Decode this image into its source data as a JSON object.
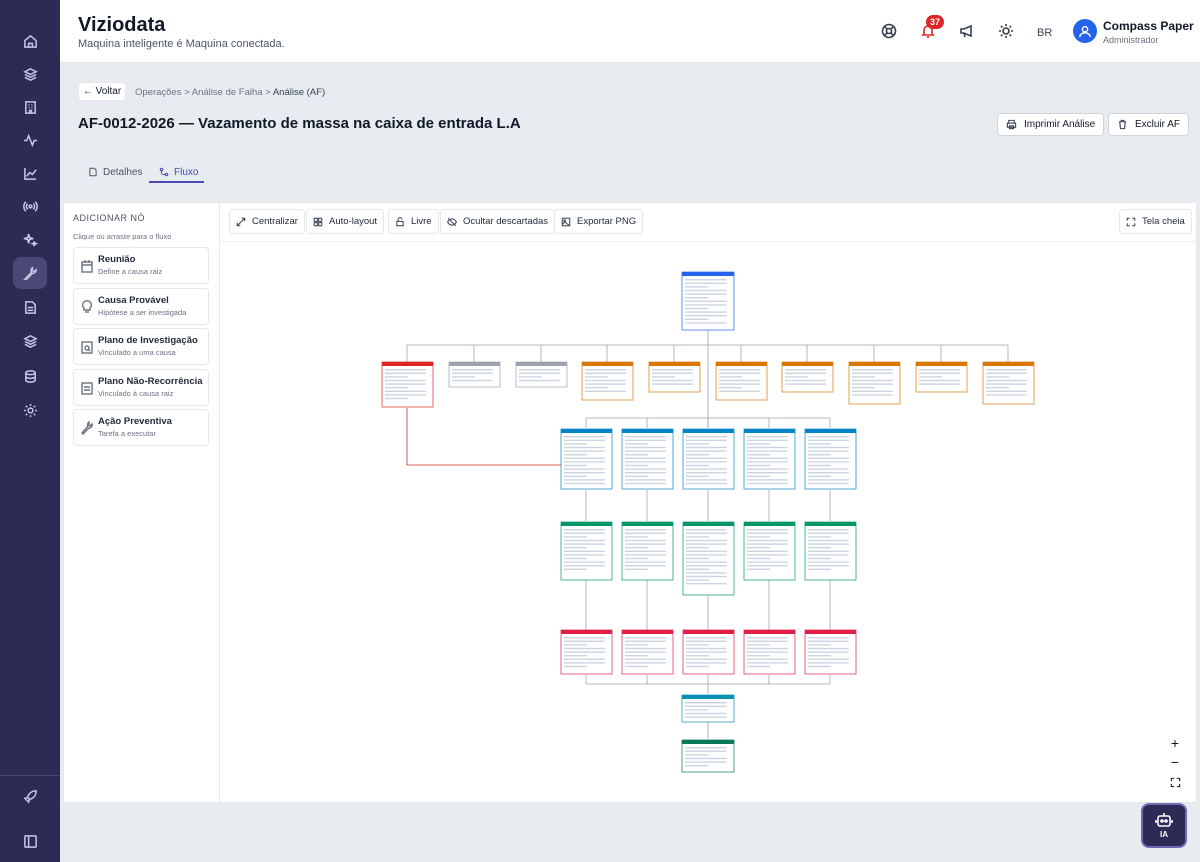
{
  "app": {
    "title": "Viziodata",
    "subtitle": "Maquina inteligente é Maquina conectada."
  },
  "header": {
    "notification_count": "37",
    "language": "BR",
    "user_name": "Compass Paper",
    "user_role": "Administrador"
  },
  "sidebar": {
    "items": [
      "home-icon",
      "layers-icon",
      "building-icon",
      "activity-icon",
      "chart-line-icon",
      "broadcast-icon",
      "sparkles-icon",
      "wrench-icon",
      "document-icon",
      "stack-icon",
      "database-icon",
      "gear-icon"
    ],
    "active_index": 7,
    "bottom": [
      "rocket-icon",
      "panel-toggle-icon"
    ]
  },
  "breadcrumb": {
    "back": "← Voltar",
    "path": "Operações > Análise de Falha > ",
    "current": "Análise (AF)"
  },
  "page": {
    "title": "AF-0012-2026 — Vazamento de massa na caixa de entrada L.A",
    "print_label": "Imprimir Análise",
    "delete_label": "Excluir AF"
  },
  "tabs": {
    "details": "Detalhes",
    "flow": "Fluxo",
    "active": "flow"
  },
  "add_node": {
    "title": "ADICIONAR NÓ",
    "hint": "Clique ou arraste para o fluxo",
    "items": [
      {
        "title": "Reunião",
        "sub": "Define a causa raiz",
        "icon": "calendar-icon"
      },
      {
        "title": "Causa Provável",
        "sub": "Hipótese a ser investigada",
        "icon": "lightbulb-icon"
      },
      {
        "title": "Plano de Investigação",
        "sub": "Vinculado a uma causa",
        "icon": "clipboard-search-icon"
      },
      {
        "title": "Plano Não-Recorrência",
        "sub": "Vinculado à causa raiz",
        "icon": "clipboard-icon"
      },
      {
        "title": "Ação Preventiva",
        "sub": "Tarefa a executar",
        "icon": "wrench-icon"
      }
    ]
  },
  "toolbar": {
    "center": "Centralizar",
    "auto_layout": "Auto-layout",
    "free": "Livre",
    "hide_discarded": "Ocultar descartadas",
    "export_png": "Exportar PNG",
    "fullscreen": "Tela cheia"
  },
  "zoom": {
    "in": "+",
    "out": "−"
  },
  "ai_button": "IA",
  "colors": {
    "sidebar": "#2d2b55",
    "accent": "#4b4ab6",
    "badge": "#dc2626",
    "meeting": "#2563eb",
    "root_cause": "#dc2626",
    "discarded": "#9ca3af",
    "probable_cause": "#d97706",
    "investigation": "#0284c7",
    "non_recurrence": "#059669",
    "preventive": "#e11d48",
    "conclusion": "#0891b2",
    "final": "#047857"
  }
}
